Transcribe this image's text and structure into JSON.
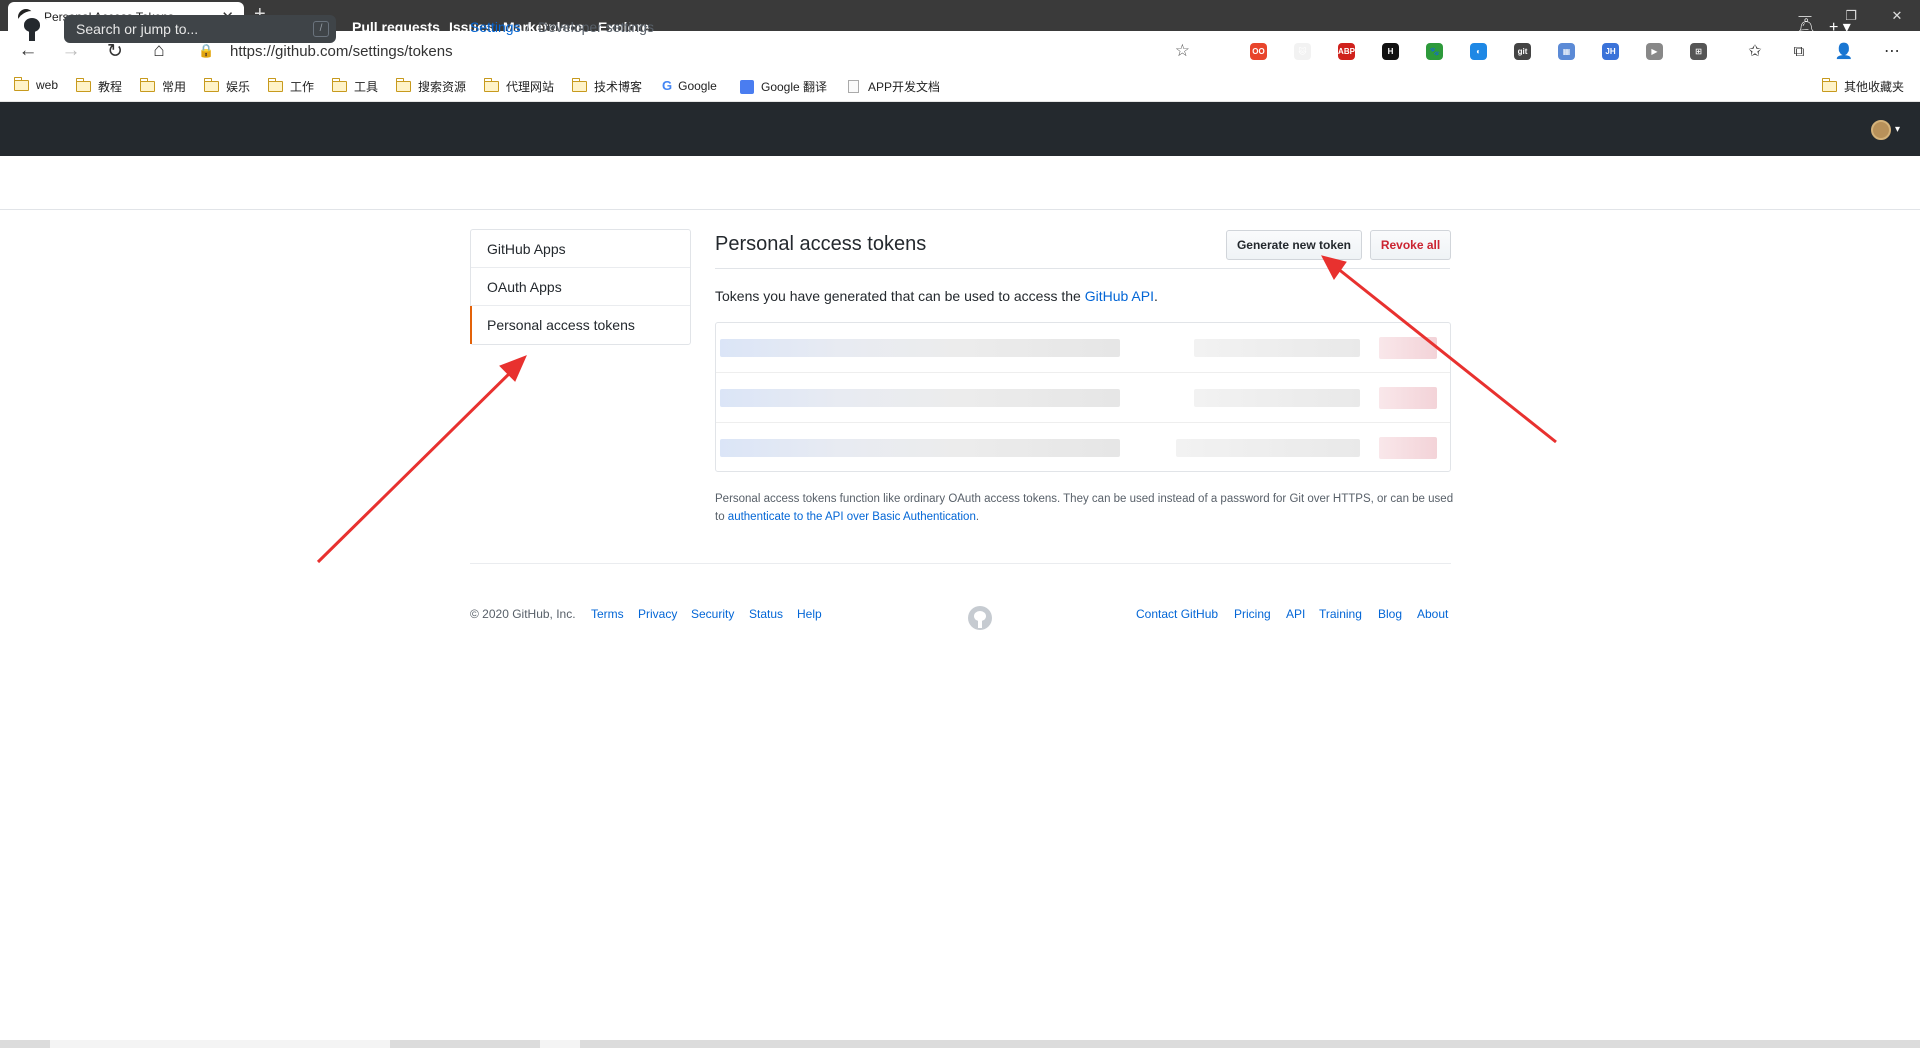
{
  "browser": {
    "tab_title": "Personal Access Tokens",
    "url": "https://github.com/settings/tokens",
    "bookmarks": [
      {
        "label": "web",
        "icon": "folder-icon"
      },
      {
        "label": "教程",
        "icon": "folder-icon"
      },
      {
        "label": "常用",
        "icon": "folder-icon"
      },
      {
        "label": "娱乐",
        "icon": "folder-icon"
      },
      {
        "label": "工作",
        "icon": "folder-icon"
      },
      {
        "label": "工具",
        "icon": "folder-icon"
      },
      {
        "label": "搜索资源",
        "icon": "folder-icon"
      },
      {
        "label": "代理网站",
        "icon": "folder-icon"
      },
      {
        "label": "技术博客",
        "icon": "folder-icon"
      },
      {
        "label": "Google",
        "icon": "google-icon"
      },
      {
        "label": "Google 翻译",
        "icon": "google-translate-icon"
      },
      {
        "label": "APP开发文档",
        "icon": "document-icon"
      }
    ],
    "other_bookmarks": "其他收藏夹",
    "extensions": [
      {
        "label": "OO",
        "color": "#e8452c"
      },
      {
        "label": "🐱",
        "color": "#f2f2f2"
      },
      {
        "label": "ABP",
        "color": "#d0211c"
      },
      {
        "label": "H",
        "color": "#111111"
      },
      {
        "label": "🐾",
        "color": "#2d9a3b"
      },
      {
        "label": "◐",
        "color": "#1e88e5"
      },
      {
        "label": "git",
        "color": "#444444"
      },
      {
        "label": "▦",
        "color": "#5b8ad6"
      },
      {
        "label": "JH",
        "color": "#3b73d9"
      },
      {
        "label": "▶",
        "color": "#888888"
      },
      {
        "label": "⊞",
        "color": "#555555"
      }
    ]
  },
  "gh_header": {
    "search_placeholder": "Search or jump to...",
    "search_hint": "/",
    "nav": [
      "Pull requests",
      "Issues",
      "Marketplace",
      "Explore"
    ]
  },
  "breadcrumb": {
    "root": "Settings",
    "current": "Developer settings"
  },
  "menu": {
    "items": [
      "GitHub Apps",
      "OAuth Apps",
      "Personal access tokens"
    ],
    "selected": "Personal access tokens"
  },
  "main": {
    "title": "Personal access tokens",
    "generate_button": "Generate new token",
    "revoke_button": "Revoke all",
    "intro_text": "Tokens you have generated that can be used to access the ",
    "intro_link": "GitHub API",
    "intro_end": ".",
    "footnote_text": "Personal access tokens function like ordinary OAuth access tokens. They can be used instead of a password for Git over HTTPS, or can be used to ",
    "footnote_link": "authenticate to the API over Basic Authentication",
    "footnote_end": "."
  },
  "footer": {
    "copyright": "© 2020 GitHub, Inc.",
    "left_links": [
      "Terms",
      "Privacy",
      "Security",
      "Status",
      "Help"
    ],
    "right_links": [
      "Contact GitHub",
      "Pricing",
      "API",
      "Training",
      "Blog",
      "About"
    ]
  },
  "colors": {
    "gh_header_bg": "#24292e",
    "link": "#0366d6",
    "danger": "#cb2431",
    "selected_marker": "#e36209",
    "annotation_arrow": "#e8312f"
  }
}
